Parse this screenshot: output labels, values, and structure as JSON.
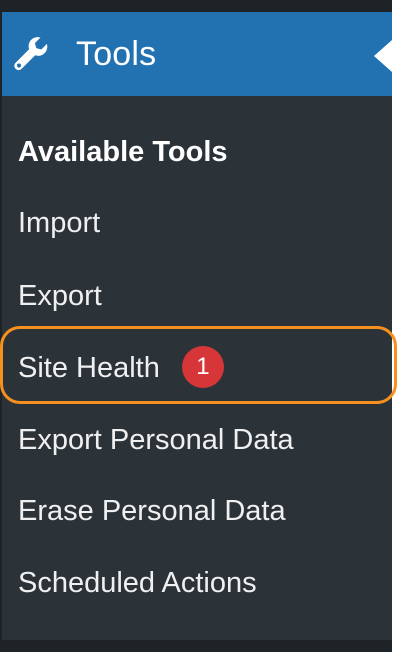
{
  "menu": {
    "title": "Tools",
    "icon": "wrench-icon",
    "accent_color": "#2271b1"
  },
  "submenu": {
    "items": [
      {
        "label": "Available Tools",
        "current": true
      },
      {
        "label": "Import"
      },
      {
        "label": "Export"
      },
      {
        "label": "Site Health",
        "badge": "1",
        "highlighted": true
      },
      {
        "label": "Export Personal Data"
      },
      {
        "label": "Erase Personal Data"
      },
      {
        "label": "Scheduled Actions"
      }
    ]
  },
  "colors": {
    "badge": "#d63638",
    "highlight_border": "#f6901e"
  }
}
